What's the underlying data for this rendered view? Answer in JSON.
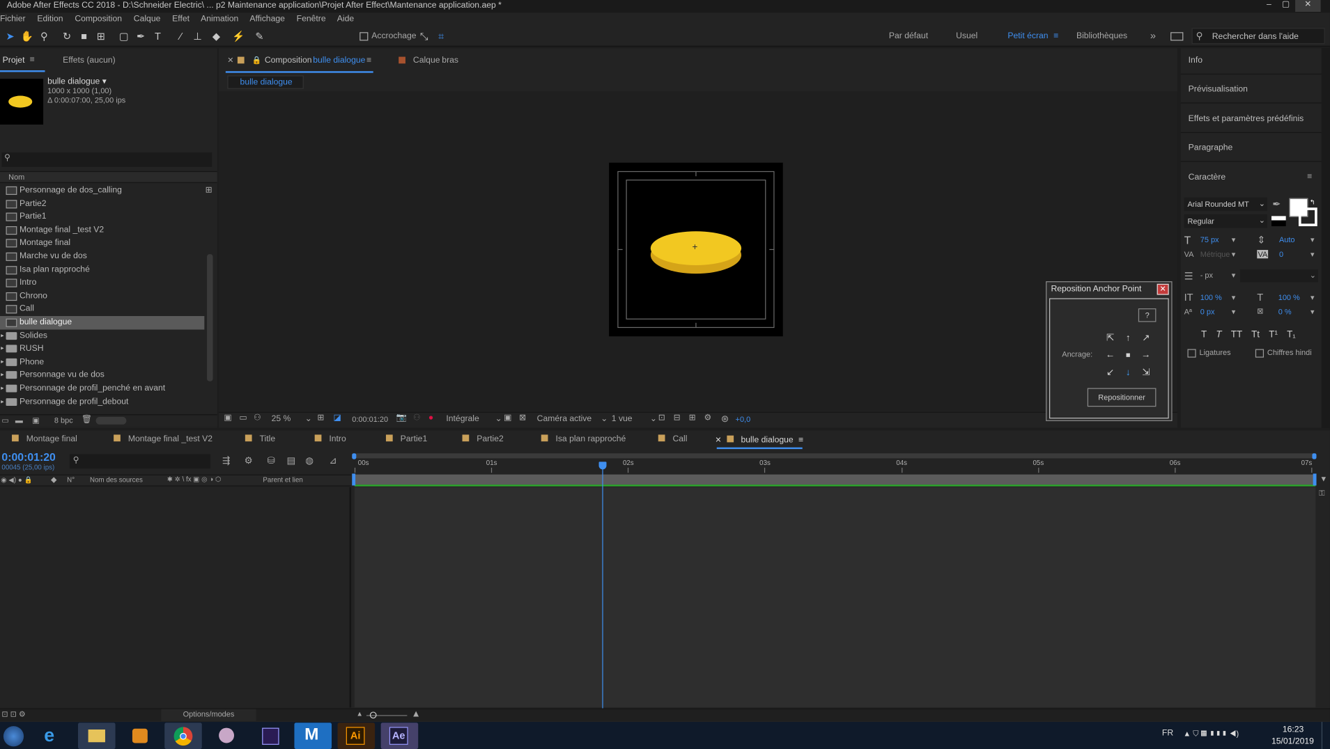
{
  "window": {
    "title": "Adobe After Effects CC 2018 - D:\\Schneider Electric\\ ... p2 Maintenance application\\Projet After Effect\\Mantenance application.aep *",
    "controls": [
      "–",
      "▢",
      "✕"
    ]
  },
  "menu": [
    "Fichier",
    "Edition",
    "Composition",
    "Calque",
    "Effet",
    "Animation",
    "Affichage",
    "Fenêtre",
    "Aide"
  ],
  "toolbar": {
    "snapping_label": "Accrochage",
    "workspaces": [
      "Par défaut",
      "Usuel",
      "Petit écran",
      "Bibliothèques"
    ],
    "active_workspace": "Petit écran",
    "search_placeholder": "Rechercher dans l'aide"
  },
  "project": {
    "tab_label": "Projet",
    "effects_tab": "Effets (aucun)",
    "selected_name": "bulle dialogue",
    "selected_info1": "1000 x 1000 (1,00)",
    "selected_info2": "Δ 0:00:07:00, 25,00 ips",
    "column_name": "Nom",
    "items": [
      {
        "name": "Personnage de dos_calling",
        "type": "comp"
      },
      {
        "name": "Partie2",
        "type": "comp"
      },
      {
        "name": "Partie1",
        "type": "comp"
      },
      {
        "name": "Montage final _test V2",
        "type": "comp"
      },
      {
        "name": "Montage final",
        "type": "comp"
      },
      {
        "name": "Marche vu de dos",
        "type": "comp"
      },
      {
        "name": "Isa plan rapproché",
        "type": "comp"
      },
      {
        "name": "Intro",
        "type": "comp"
      },
      {
        "name": "Chrono",
        "type": "comp"
      },
      {
        "name": "Call",
        "type": "comp"
      },
      {
        "name": "bulle dialogue",
        "type": "comp",
        "selected": true
      },
      {
        "name": "Solides",
        "type": "folder"
      },
      {
        "name": "RUSH",
        "type": "folder"
      },
      {
        "name": "Phone",
        "type": "folder"
      },
      {
        "name": "Personnage vu de dos",
        "type": "folder"
      },
      {
        "name": "Personnage de profil_penché en avant",
        "type": "folder"
      },
      {
        "name": "Personnage de profil_debout",
        "type": "folder"
      }
    ],
    "bpc": "8 bpc"
  },
  "composition": {
    "tab_prefix": "Composition",
    "tab_name": "bulle dialogue",
    "layer_tab_prefix": "Calque",
    "layer_tab_name": "bras",
    "breadcrumb": "bulle dialogue",
    "zoom": "25 %",
    "timecode": "0:00:01:20",
    "resolution": "Intégrale",
    "camera": "Caméra active",
    "views": "1 vue",
    "exposure": "+0,0",
    "shape_color": "#f2c821"
  },
  "anchor_dialog": {
    "title": "Reposition Anchor Point",
    "help": "?",
    "label": "Ancrage:",
    "button": "Repositionner"
  },
  "right_panels": [
    "Info",
    "Prévisualisation",
    "Effets et paramètres prédéfinis",
    "Paragraphe",
    "Caractère"
  ],
  "character": {
    "font": "Arial Rounded MT",
    "style": "Regular",
    "size": "75 px",
    "leading": "Auto",
    "kerning": "Métrique",
    "tracking": "0",
    "stroke": "- px",
    "vscale": "100 %",
    "hscale": "100 %",
    "baseline": "0 px",
    "tsume": "0 %",
    "ligatures": "Ligatures",
    "hindi": "Chiffres hindi",
    "style_buttons": [
      "T",
      "T",
      "TT",
      "Tt",
      "T¹",
      "T₁"
    ]
  },
  "timeline": {
    "tabs": [
      "Montage final",
      "Montage final _test V2",
      "Title",
      "Intro",
      "Partie1",
      "Partie2",
      "Isa plan rapproché",
      "Call",
      "bulle dialogue"
    ],
    "active_tab": "bulle dialogue",
    "timecode": "0:00:01:20",
    "frame_info": "00045 (25,00 ips)",
    "col_num": "N°",
    "col_source": "Nom des sources",
    "col_parent": "Parent et lien",
    "ruler": [
      "00s",
      "01s",
      "02s",
      "03s",
      "04s",
      "05s",
      "06s",
      "07s"
    ],
    "options_label": "Options/modes"
  },
  "taskbar": {
    "lang": "FR",
    "time": "16:23",
    "date": "15/01/2019",
    "apps": [
      "windows-start",
      "internet-explorer",
      "file-explorer",
      "media-player",
      "chrome",
      "paint",
      "premiere",
      "m-app",
      "illustrator",
      "after-effects"
    ],
    "ai_label": "Ai",
    "ae_label": "Ae",
    "m_label": "M"
  }
}
